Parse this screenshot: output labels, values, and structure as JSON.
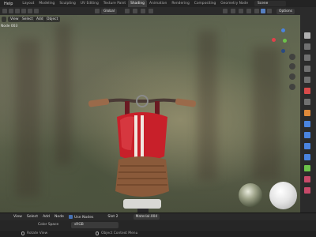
{
  "topbar": {
    "menu": [
      "Help"
    ],
    "workspaces": [
      "Layout",
      "Modeling",
      "Sculpting",
      "UV Editing",
      "Texture Paint",
      "Shading",
      "Animation",
      "Rendering",
      "Compositing",
      "Geometry Node"
    ],
    "active_workspace": "Shading",
    "scene": "Scene"
  },
  "viewport_header": {
    "menus": [
      "View",
      "Select",
      "Add",
      "Object"
    ],
    "orientation": "Global",
    "options": "Options"
  },
  "viewport": {
    "object_name": "Node 003"
  },
  "node_header": {
    "menus": [
      "View",
      "Select",
      "Add",
      "Node"
    ],
    "use_nodes": "Use Nodes",
    "slot": "Slot 2",
    "material": "Material.004"
  },
  "node_body": {
    "color_space_label": "Color Space",
    "color_space_value": "sRGB"
  },
  "status": {
    "left": "Rotate View",
    "middle": "Object Context Menu"
  },
  "colors": {
    "accent_blue": "#4772b3",
    "tank_red": "#c8202a",
    "seat_brown": "#8a5a3a",
    "axis_x": "#e0404a",
    "axis_y": "#6cc24a",
    "axis_z": "#4a84e0"
  }
}
